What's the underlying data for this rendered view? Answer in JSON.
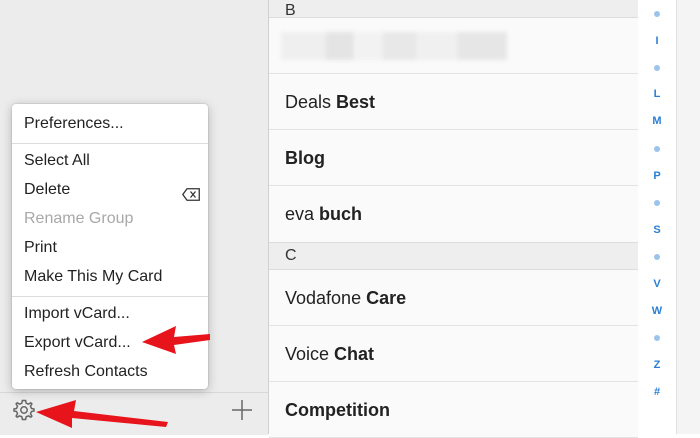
{
  "menu": {
    "items": [
      {
        "label": "Preferences...",
        "enabled": true
      },
      {
        "label": "Select All",
        "enabled": true
      },
      {
        "label": "Delete",
        "enabled": true
      },
      {
        "label": "Rename Group",
        "enabled": false
      },
      {
        "label": "Print",
        "enabled": true
      },
      {
        "label": "Make This My Card",
        "enabled": true
      },
      {
        "label": "Import vCard...",
        "enabled": true
      },
      {
        "label": "Export vCard...",
        "enabled": true
      },
      {
        "label": "Refresh Contacts",
        "enabled": true
      }
    ],
    "delete_shortcut_icon": "delete-key-icon"
  },
  "footer": {
    "gear_icon": "gear-icon",
    "add_icon": "plus-icon"
  },
  "contacts": {
    "sections": [
      {
        "letter": "B",
        "rows": [
          {
            "first": "",
            "last": "",
            "redacted": true
          },
          {
            "first": "Deals",
            "last": "Best"
          },
          {
            "first": "",
            "last": "Blog"
          },
          {
            "first": "eva",
            "last": "buch"
          }
        ]
      },
      {
        "letter": "C",
        "rows": [
          {
            "first": "Vodafone",
            "last": "Care"
          },
          {
            "first": "Voice",
            "last": "Chat"
          },
          {
            "first": "",
            "last": "Competition"
          }
        ]
      }
    ]
  },
  "index_bar": [
    "I",
    "L",
    "M",
    "P",
    "S",
    "V",
    "W",
    "Z",
    "#"
  ],
  "colors": {
    "accent": "#2a7fd4",
    "annotation_arrow": "#e8141b"
  }
}
